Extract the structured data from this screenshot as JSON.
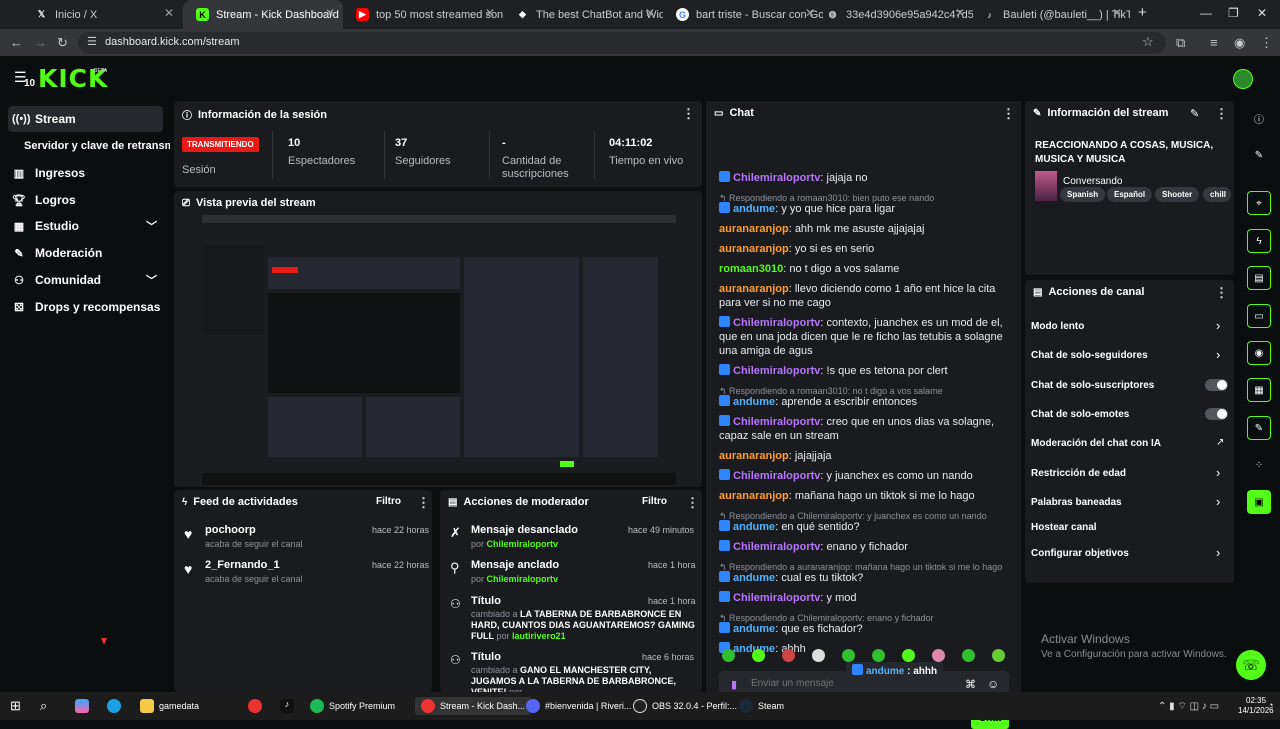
{
  "browser": {
    "tabs": [
      {
        "title": "Inicio / X",
        "icon": "x-logo-icon"
      },
      {
        "title": "Stream - Kick Dashboard",
        "icon": "kick-logo-icon"
      },
      {
        "title": "top 50 most streamed songs fr",
        "icon": "youtube-icon"
      },
      {
        "title": "The best ChatBot and Widgets",
        "icon": "botrix-icon"
      },
      {
        "title": "bart triste - Buscar con Google",
        "icon": "google-icon"
      },
      {
        "title": "33e4d3906e95a942c47d5f3672",
        "icon": "globe-icon"
      },
      {
        "title": "Bauleti (@bauleti__) | TikTok",
        "icon": "tiktok-icon"
      }
    ],
    "url": "dashboard.kick.com/stream"
  },
  "header": {
    "logo": "KICK",
    "badge": "BETA",
    "notif_count": "10"
  },
  "sidebar": {
    "items": [
      {
        "label": "Stream",
        "icon": "broadcast-icon"
      },
      {
        "label": "Servidor y clave de retransm"
      },
      {
        "label": "Ingresos",
        "icon": "bar-chart-icon"
      },
      {
        "label": "Logros",
        "icon": "trophy-icon"
      },
      {
        "label": "Estudio",
        "icon": "studio-icon"
      },
      {
        "label": "Moderación",
        "icon": "wrench-icon"
      },
      {
        "label": "Comunidad",
        "icon": "community-icon"
      },
      {
        "label": "Drops y recompensas",
        "icon": "gift-icon"
      }
    ]
  },
  "session": {
    "title": "Información de la sesión",
    "live": "TRANSMITIENDO",
    "live_label": "Sesión",
    "stats": [
      {
        "value": "10",
        "label": "Espectadores"
      },
      {
        "value": "37",
        "label": "Seguidores"
      },
      {
        "value": "-",
        "label": "Cantidad de suscripciones"
      },
      {
        "value": "04:11:02",
        "label": "Tiempo en vivo"
      }
    ]
  },
  "preview": {
    "title": "Vista previa del stream"
  },
  "feed": {
    "title": "Feed de actividades",
    "filter": "Filtro",
    "items": [
      {
        "name": "pochoorp",
        "sub": "acaba de seguir el canal",
        "time": "hace 22 horas"
      },
      {
        "name": "2_Fernando_1",
        "sub": "acaba de seguir el canal",
        "time": "hace 22 horas"
      }
    ]
  },
  "modactions": {
    "title": "Acciones de moderador",
    "filter": "Filtro",
    "items": [
      {
        "title": "Mensaje desanclado",
        "pre": "por",
        "user": "Chilemiraloportv",
        "time": "hace 49 minutos"
      },
      {
        "title": "Mensaje anclado",
        "pre": "por",
        "user": "Chilemiraloportv",
        "time": "hace 1 hora"
      },
      {
        "title": "Título",
        "pre": "cambiado a",
        "bold": "LA TABERNA DE BARBABRONCE EN HARD, CUANTOS DIAS AGUANTAREMOS? GAMING FULL",
        "pre2": "por",
        "user": "lautirivero21",
        "time": "hace 1 hora"
      },
      {
        "title": "Título",
        "pre": "cambiado a",
        "bold": "GANO EL MANCHESTER CITY, JUGAMOS A LA TABERNA DE BARBABRONCE, VENITE!",
        "pre2": "por",
        "time": "hace 6 horas"
      }
    ]
  },
  "chat": {
    "title": "Chat",
    "messages": [
      {
        "user": "Chilemiraloportv",
        "badge": true,
        "color": "#b974ff",
        "text": "jajaja no"
      },
      {
        "reply": "Respondiendo a romaan3010: bien puto ese nando"
      },
      {
        "user": "andume",
        "badge": true,
        "color": "#4fb3ff",
        "text": "y yo que hice para ligar"
      },
      {
        "user": "auranaranjop",
        "color": "#ff9d2e",
        "text": "ahh mk me asuste ajjajajaj"
      },
      {
        "user": "auranaranjop",
        "color": "#ff9d2e",
        "text": "yo si es en serio"
      },
      {
        "user": "romaan3010",
        "color": "#53fc18",
        "text": "no t digo a vos salame"
      },
      {
        "user": "auranaranjop",
        "color": "#ff9d2e",
        "text": "llevo diciendo como 1 año ent hice la cita para ver si no me cago"
      },
      {
        "user": "Chilemiraloportv",
        "badge": true,
        "color": "#b974ff",
        "text": "contexto, juanchex es un mod de el, que en una joda dicen que le re ficho las tetubis a solagne una amiga de agus"
      },
      {
        "user": "Chilemiraloportv",
        "badge": true,
        "color": "#b974ff",
        "text": "!s que es tetona por clert"
      },
      {
        "reply": "Respondiendo a romaan3010: no t digo a vos salame"
      },
      {
        "user": "andume",
        "badge": true,
        "color": "#4fb3ff",
        "text": "aprende a escribir entonces"
      },
      {
        "user": "Chilemiraloportv",
        "badge": true,
        "color": "#b974ff",
        "text": "creo que en unos dias va solagne, capaz sale en un stream"
      },
      {
        "user": "auranaranjop",
        "color": "#ff9d2e",
        "text": "jajajjaja"
      },
      {
        "user": "Chilemiraloportv",
        "badge": true,
        "color": "#b974ff",
        "text": "y juanchex es como un nando"
      },
      {
        "user": "auranaranjop",
        "color": "#ff9d2e",
        "text": "mañana hago un tiktok si me lo hago"
      },
      {
        "reply": "Respondiendo a Chilemiraloportv: y juanchex es como un nando"
      },
      {
        "user": "andume",
        "badge": true,
        "color": "#4fb3ff",
        "text": "en qué sentido?"
      },
      {
        "user": "Chilemiraloportv",
        "badge": true,
        "color": "#b974ff",
        "text": "enano y fichador"
      },
      {
        "reply": "Respondiendo a auranaranjop: mañana hago un tiktok si me lo hago"
      },
      {
        "user": "andume",
        "badge": true,
        "color": "#4fb3ff",
        "text": "cual es tu tiktok?"
      },
      {
        "user": "Chilemiraloportv",
        "badge": true,
        "color": "#b974ff",
        "text": "y mod"
      },
      {
        "reply": "Respondiendo a Chilemiraloportv: enano y fichador"
      },
      {
        "user": "andume",
        "badge": true,
        "color": "#4fb3ff",
        "text": "que es fichador?"
      },
      {
        "user": "andume",
        "badge": true,
        "color": "#4fb3ff",
        "text": "ahhh"
      }
    ],
    "placeholder": "Enviar un mensaje",
    "send": "Chat",
    "overlay_user": "andume",
    "overlay_text": ": ahhh",
    "infinity": "∞"
  },
  "streaminfo": {
    "title": "Información del stream",
    "stream_title": "REACCIONANDO A COSAS, MUSICA, MUSICA Y MUSICA",
    "category": "Conversando",
    "tags": [
      "Spanish",
      "Español",
      "Shooter",
      "chill"
    ]
  },
  "channel": {
    "title": "Acciones de canal",
    "rows": [
      {
        "label": "Modo lento",
        "kind": "arrow"
      },
      {
        "label": "Chat de solo-seguidores",
        "kind": "arrow"
      },
      {
        "label": "Chat de solo-suscriptores",
        "kind": "toggle"
      },
      {
        "label": "Chat de solo-emotes",
        "kind": "toggle"
      },
      {
        "label": "Moderación del chat con IA",
        "kind": "ext"
      },
      {
        "label": "Restricción de edad",
        "kind": "arrow"
      },
      {
        "label": "Palabras baneadas",
        "kind": "arrow"
      },
      {
        "label": "Hostear canal",
        "kind": "none"
      },
      {
        "label": "Configurar objetivos",
        "kind": "arrow"
      }
    ]
  },
  "windows": {
    "activate_title": "Activar Windows",
    "activate_sub": "Ve a Configuración para activar Windows."
  },
  "taskbar": {
    "items": [
      "gamedata",
      "Spotify Premium",
      "Stream - Kick Dash...",
      "#bienvenida | Riveri...",
      "OBS 32.0.4 - Perfil:...",
      "Steam"
    ],
    "time": "02:35",
    "date": "14/1/2026"
  }
}
